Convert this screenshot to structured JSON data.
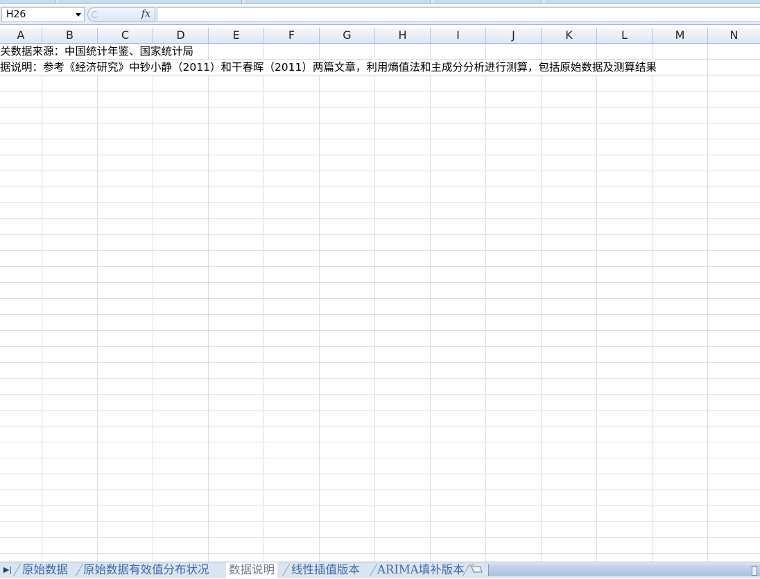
{
  "ribbon": {
    "segments": 5
  },
  "formula_bar": {
    "name_box": "H26",
    "fx_label": "fx",
    "formula_value": ""
  },
  "columns": [
    "A",
    "B",
    "C",
    "D",
    "E",
    "F",
    "G",
    "H",
    "I",
    "J",
    "K",
    "L",
    "M",
    "N"
  ],
  "cells": {
    "A1": "关数据来源：中国统计年鉴、国家统计局",
    "A2": "据说明：参考《经济研究》中钞小静（2011）和干春晖（2011）两篇文章，利用熵值法和主成分分析进行测算，包括原始数据及测算结果"
  },
  "sheet_tabs": {
    "nav_label": "▶|",
    "tabs": [
      "原始数据",
      "原始数据有效值分布状况",
      "数据说明",
      "线性插值版本",
      "ARIMA填补版本"
    ],
    "active": "数据说明"
  },
  "colors": {
    "header_bg": "#dde7f3",
    "grid_line": "#d4dde8",
    "tab_text": "#3b6aa3",
    "active_tab_bg": "#ffffff"
  }
}
